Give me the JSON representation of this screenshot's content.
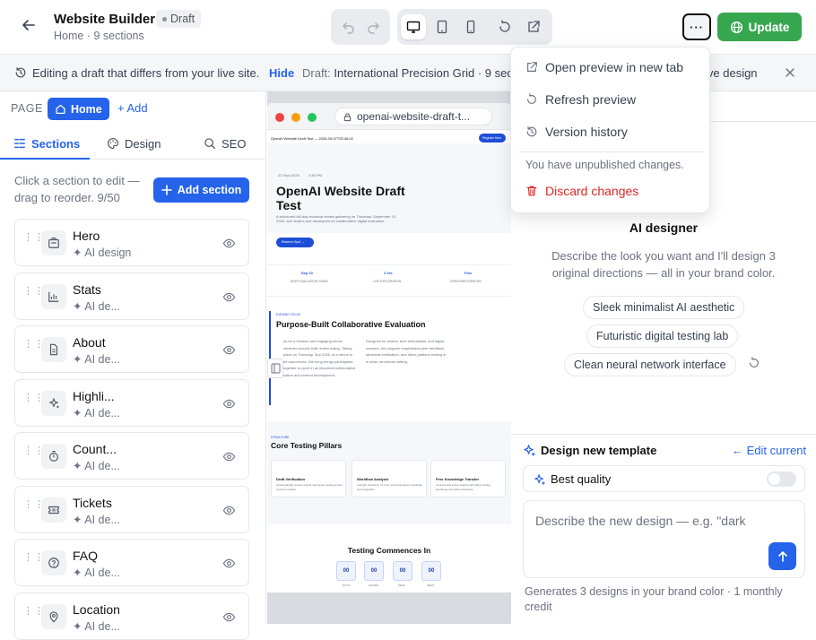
{
  "header": {
    "title": "Website Builder",
    "badge": "Draft",
    "subtitle": "Home · 9 sections",
    "update_label": "Update",
    "more_label": "···"
  },
  "banner": {
    "text": "Editing a draft that differs from your live site.",
    "hide_label": "Hide",
    "draft_prefix": "Draft:",
    "draft_name": "International Precision Grid · 9 sections",
    "tail_text": "ive design"
  },
  "menu": {
    "items": [
      {
        "label": "Open preview in new tab",
        "icon": "external-link-icon"
      },
      {
        "label": "Refresh preview",
        "icon": "refresh-icon"
      },
      {
        "label": "Version history",
        "icon": "history-icon"
      }
    ],
    "note": "You have unpublished changes.",
    "discard_label": "Discard changes"
  },
  "leftpanel": {
    "page_label": "PAGE",
    "home_label": "Home",
    "add_label": "+ Add",
    "tabs": [
      {
        "label": "Sections",
        "icon": "sections-icon",
        "active": true
      },
      {
        "label": "Design",
        "icon": "palette-icon",
        "active": false
      },
      {
        "label": "SEO",
        "icon": "search-icon",
        "active": false
      }
    ],
    "hint": "Click a section to edit — drag to reorder. 9/50",
    "add_section_label": "Add section",
    "sections": [
      {
        "name": "Hero",
        "tag": "✦ AI design",
        "icon": "hero-icon"
      },
      {
        "name": "Stats",
        "tag": "✦ AI de...",
        "icon": "chart-icon"
      },
      {
        "name": "About",
        "tag": "✦ AI de...",
        "icon": "document-icon"
      },
      {
        "name": "Highli...",
        "tag": "✦ AI de...",
        "icon": "sparkle-icon"
      },
      {
        "name": "Count...",
        "tag": "✦ AI de...",
        "icon": "timer-icon"
      },
      {
        "name": "Tickets",
        "tag": "✦ AI de...",
        "icon": "ticket-icon"
      },
      {
        "name": "FAQ",
        "tag": "✦ AI de...",
        "icon": "help-icon"
      },
      {
        "name": "Location",
        "tag": "✦ AI de...",
        "icon": "pin-icon"
      }
    ]
  },
  "preview": {
    "url": "openai-website-draft-t...",
    "site_header": "OpenAI Website Draft Test — 2026-09-07T20:46:02",
    "register_label": "Register Now",
    "hero_date": "22 Sept 2026",
    "hero_time": "2:30 PM",
    "hero_title": "OpenAI Website Draft Test",
    "hero_desc": "A structured full-day technical review gathering on Thursday, September 10, 2026. Join testers and developers for collaborative digital evaluation.",
    "hero_cta": "Reserve Spot →",
    "stats": [
      {
        "value": "Sep 10",
        "label": "DEEP EVALUATION TODAY"
      },
      {
        "value": "2 hrs",
        "label": "LIVE EXPLORATION"
      },
      {
        "value": "Free",
        "label": "OPEN PARTICIPATION"
      }
    ],
    "section2_kicker": "EVENING FOCUS",
    "section2_title": "Purpose-Built Collaborative Evaluation",
    "section2_left": "us for a focused and engaging rience centered around draft review esting. Taking place on Thursday, Sep 2026, at a venue to be announced, this ering brings participants together to pport in an important collaborative uation and content development.",
    "section2_right": "Designed for testers, tech enthusiasts, and digital creators, the program emphasizes peer feedback, structural verification, and direct platform testing in a clean, structured setting.",
    "section3_kicker": "STRUCTURE",
    "section3_title": "Core Testing Pillars",
    "pillars": [
      {
        "title": "Draft Verification",
        "desc": "Systematically review content and layout testing across various modules."
      },
      {
        "title": "Workflow Analysis",
        "desc": "In-depth inspection of every structural aspect. Evaluate and integration."
      },
      {
        "title": "Peer Knowledge Transfer",
        "desc": "Connect and share insights with fellow testing. Exchange innovative advances."
      }
    ],
    "countdown_title": "Testing Commences In",
    "countdown": [
      {
        "value": "00",
        "label": "DAYS"
      },
      {
        "value": "00",
        "label": "HOURS"
      },
      {
        "value": "00",
        "label": "MINS"
      },
      {
        "value": "00",
        "label": "SECS"
      }
    ]
  },
  "rightpanel": {
    "ai_title": "AI designer",
    "ai_desc": "Describe the look you want and I'll design 3 original directions — all in your brand color.",
    "chips": [
      "Sleek minimalist AI aesthetic",
      "Futuristic digital testing lab",
      "Clean neural network interface"
    ],
    "design_new_label": "Design new template",
    "edit_current_label": "← Edit current",
    "best_quality_label": "Best quality",
    "best_quality_on": false,
    "prompt_placeholder": "Describe the new design — e.g. \"dark",
    "foot_note": "Generates 3 designs in your brand color · 1 monthly credit"
  },
  "colors": {
    "accent": "#2563eb",
    "update": "#36a64f",
    "danger": "#dc2626"
  }
}
